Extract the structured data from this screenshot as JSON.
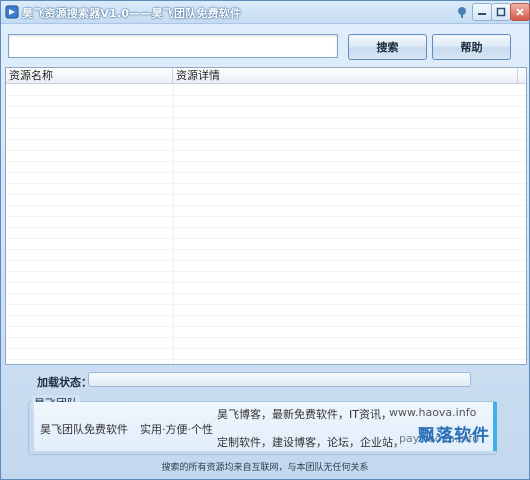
{
  "window": {
    "title": "昊飞资源搜索器V1.0——昊飞团队免费软件"
  },
  "toolbar": {
    "search_value": "",
    "search_placeholder": "",
    "search_label": "搜索",
    "help_label": "帮助"
  },
  "table": {
    "columns": [
      "资源名称",
      "资源详情"
    ],
    "rows": []
  },
  "status": {
    "label": "加载状态：",
    "progress": 0
  },
  "ad": {
    "group_title": "昊飞团队",
    "slogan_left": "昊飞团队免费软件",
    "slogan_mid": "实用·方便·个性",
    "line1": "昊飞博客，最新免费软件，IT资讯，",
    "url1": "www.haova.info",
    "line2": "定制软件，建设博客，论坛，企业站，",
    "url2": "pay.haova.info",
    "brand": "飘落软件"
  },
  "footer": {
    "text": "搜索的所有资源均来自互联网，与本团队无任何关系"
  },
  "colors": {
    "accent": "#3fb0e8",
    "window_border": "#5c8bbd",
    "progress": "#56a0e0"
  }
}
